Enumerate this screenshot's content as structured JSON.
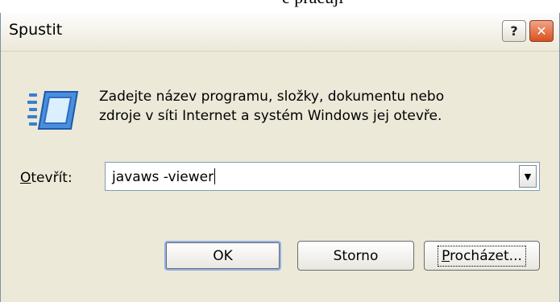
{
  "background_fragment": "e pracuji",
  "window": {
    "title": "Spustit",
    "help_glyph": "?",
    "close_glyph": "✕"
  },
  "message": {
    "line1": "Zadejte název programu, složky, dokumentu nebo",
    "line2": "zdroje v síti Internet a systém Windows jej otevře."
  },
  "open_field": {
    "label_mnemonic": "O",
    "label_rest": "tevřít:",
    "value": "javaws -viewer",
    "dropdown_glyph": "▼"
  },
  "buttons": {
    "ok": "OK",
    "cancel": "Storno",
    "browse_mnemonic": "P",
    "browse_rest": "rocházet..."
  },
  "icons": {
    "run": "run-program-icon",
    "help": "help-icon",
    "close": "close-icon",
    "dropdown": "chevron-down-icon"
  },
  "colors": {
    "dialog_background": "#ece9d8",
    "close_button": "#d8501f",
    "focus_border": "#8fb0e8"
  }
}
